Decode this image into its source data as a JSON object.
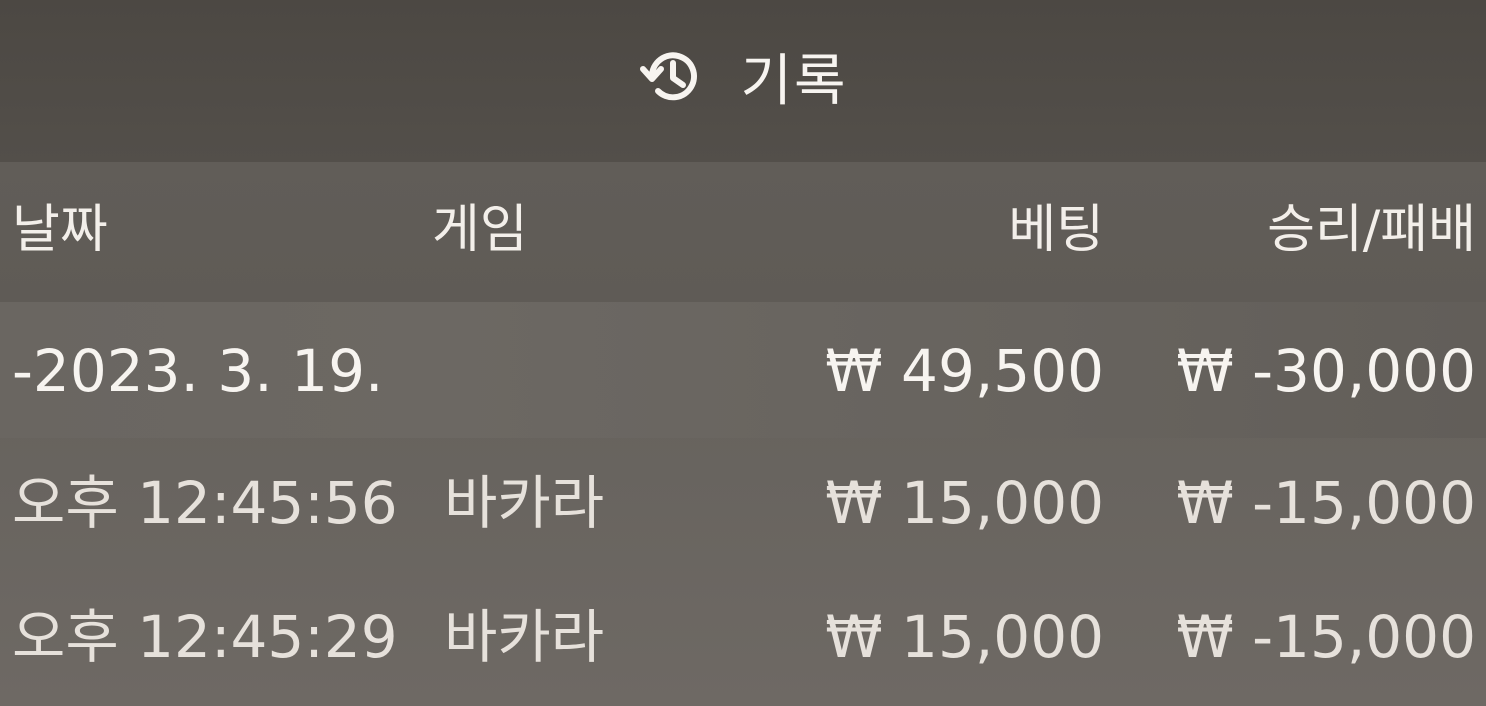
{
  "header": {
    "icon": "history-icon",
    "title": "기록"
  },
  "table": {
    "columns": {
      "date": "날짜",
      "game": "게임",
      "bet": "베팅",
      "result": "승리/패배"
    },
    "summary": {
      "date": "-2023. 3. 19.",
      "game": "",
      "bet": "₩ 49,500",
      "result": "₩ -30,000"
    },
    "rows": [
      {
        "time": "오후 12:45:56",
        "game": "바카라",
        "bet": "₩ 15,000",
        "result": "₩ -15,000"
      },
      {
        "time": "오후 12:45:29",
        "game": "바카라",
        "bet": "₩ 15,000",
        "result": "₩ -15,000"
      }
    ]
  }
}
